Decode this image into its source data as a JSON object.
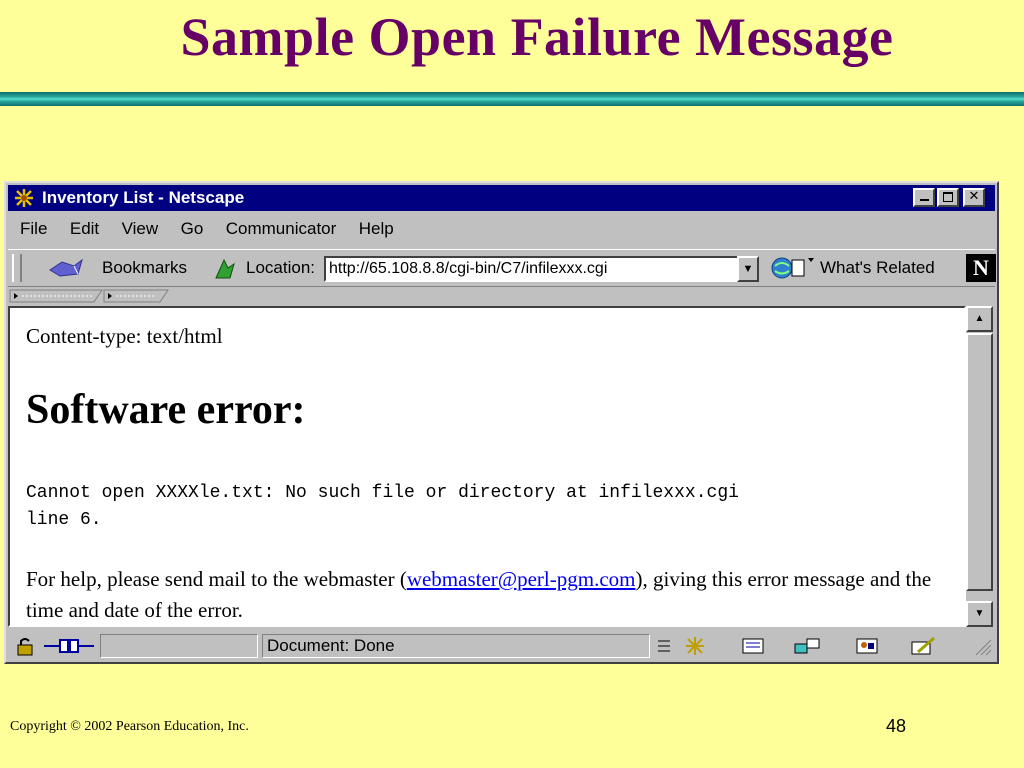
{
  "slide": {
    "title": "Sample Open Failure Message",
    "copyright": "Copyright © 2002 Pearson Education, Inc.",
    "page_number": "48"
  },
  "browser": {
    "window_title": "Inventory List - Netscape",
    "menu": [
      "File",
      "Edit",
      "View",
      "Go",
      "Communicator",
      "Help"
    ],
    "toolbar": {
      "bookmarks_label": "Bookmarks",
      "location_label": "Location:",
      "location_value": "http://65.108.8.8/cgi-bin/C7/infilexxx.cgi",
      "whats_related_label": "What's Related",
      "logo_letter": "N"
    },
    "page": {
      "content_type_line": "Content-type: text/html",
      "error_heading": "Software error:",
      "error_message": "Cannot open XXXXle.txt: No such file or directory at infilexxx.cgi\nline 6.",
      "help_prefix": "For help, please send mail to the webmaster (",
      "help_link": "webmaster@perl-pgm.com",
      "help_suffix": "), giving this error message and the time and date of the error."
    },
    "status": {
      "text": "Document: Done"
    }
  }
}
